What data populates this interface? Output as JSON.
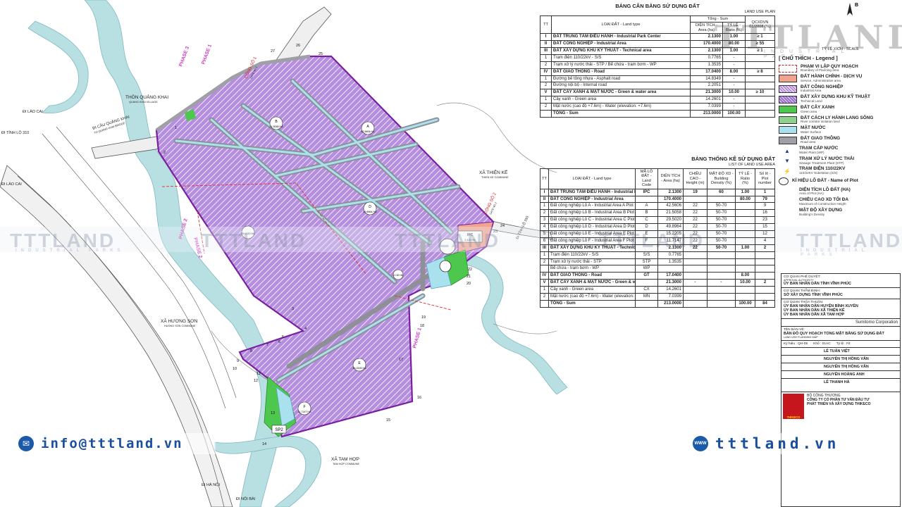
{
  "colors": {
    "industrial_fill": "#b58ee0",
    "industrial_hatch": "#ffffff",
    "boundary": "#7a1fa0",
    "green": "#4ec74e",
    "water": "#a9e2ee",
    "road": "#9f9fa6",
    "service": "#f2a38f",
    "river": "#b8e0e3",
    "watermark": "#8a93a8",
    "brand_blue": "#1a4f9e"
  },
  "map": {
    "labels": {
      "village_quang_khai": "THÔN QUẢNG KHAI",
      "village_quang_khai_en": "QUANG KHAI VILLAGE",
      "bridge": "ĐI CẦU QUẢNG KHAI",
      "bridge_en": "TO QUANG KHAI BRIDGE",
      "to_lao_cai_1": "ĐI LÀO CAI",
      "to_lao_cai_2": "ĐI LÀO CAI",
      "to_tinh_lo_310": "ĐI TỈNH LỘ 310",
      "to_ha_noi": "ĐI HÀ NỘI",
      "to_noi_bai": "ĐI NỘI BÀI",
      "xa_thien_ke": "XÃ THIỆN KẾ",
      "xa_thien_ke_en": "THIEN KE COMMUNE",
      "xa_huong_son": "XÃ HƯƠNG SƠN",
      "xa_huong_son_en": "HUONG SON COMMUNE",
      "xa_tam_hop": "XÃ TAM HỢP",
      "xa_tam_hop_en": "TAM HOP COMMUNE",
      "gate1": "CỔNG SỐ 1",
      "gate1_en": "GATE NO.1",
      "gate2": "CỔNG SỐ 2",
      "gate2_en": "GATE NO.2",
      "tinh_lo_310": "ĐI TỈNH LỘ 310",
      "phase1_a": "PHASE 1",
      "phase1_b": "PHASE 1",
      "phase2_a": "PHASE 2",
      "phase2_b": "PHASE 2",
      "phase3": "PHASE 3",
      "ipc": "IPC",
      "ipc_area": "2.130 HA",
      "sp2": "SP2",
      "plot_a": "A",
      "plot_a_area": "42.5606 HA",
      "plot_b": "B",
      "plot_b_area": "21.5058 HA",
      "plot_d": "D",
      "plot_d_area": "49.8964 HA",
      "plot_c_area": "29.5020 HA",
      "plot_e": "E",
      "plot_e_area": "15.2205 HA",
      "plot_f": "F",
      "plot_f_area": "11.7147 HA",
      "plot_small_area": "2.130 HA"
    },
    "boundary_points": [
      "1",
      "2",
      "3",
      "4",
      "5",
      "6",
      "7",
      "8",
      "9",
      "10",
      "11",
      "12",
      "13",
      "14",
      "15",
      "16",
      "17",
      "18",
      "19",
      "20",
      "21",
      "22",
      "23",
      "24",
      "25",
      "26",
      "27"
    ]
  },
  "land_balance": {
    "title": "BẢNG CÂN BẰNG SỬ DỤNG ĐẤT",
    "subtitle": "LAND USE PLAN",
    "headers": {
      "tt": "TT",
      "land_type": "LOẠI ĐẤT - Land type",
      "total": "Tổng - Sum",
      "area": "DIỆN TÍCH - Area (ha)",
      "ratio": "TỶ LỆ - Ratio (%)",
      "qc": "QCXDVN 01/2008 (%)"
    },
    "rows": [
      {
        "tt": "I",
        "name": "ĐẤT TRUNG TÂM ĐIỀU HÀNH - Industrial Park Center",
        "area": "2.1300",
        "ratio": "1.00",
        "qc": "≥ 1",
        "bold": true
      },
      {
        "tt": "II",
        "name": "ĐẤT CÔNG NGHIỆP - Industrial Area",
        "area": "170.4000",
        "ratio": "80.00",
        "qc": "≥ 55",
        "bold": true
      },
      {
        "tt": "III",
        "name": "ĐẤT XÂY DỰNG KHU KỸ THUẬT - Technical area",
        "area": "2.1300",
        "ratio": "1.00",
        "qc": "≥ 1",
        "bold": true
      },
      {
        "tt": "1",
        "name": "Trạm điện 110/22kV - S/S",
        "area": "0.7765",
        "ratio": "-",
        "qc": "",
        "bold": false
      },
      {
        "tt": "2",
        "name": "Trạm xử lý nước thải - STP / Bể chứa - trạm bơm - WP",
        "area": "1.3535",
        "ratio": "-",
        "qc": "",
        "bold": false
      },
      {
        "tt": "IV",
        "name": "ĐẤT GIAO THÔNG - Road",
        "area": "17.0400",
        "ratio": "8.00",
        "qc": "≥ 8",
        "bold": true
      },
      {
        "tt": "1",
        "name": "Đường bê tông nhựa - Asphalt road",
        "area": "14.8349",
        "ratio": "-",
        "qc": "",
        "bold": false
      },
      {
        "tt": "2",
        "name": "Đường nội bộ - Internal road",
        "area": "2.2051",
        "ratio": "-",
        "qc": "",
        "bold": false
      },
      {
        "tt": "V",
        "name": "ĐẤT CÂY XANH & MẶT NƯỚC - Green & water area",
        "area": "21.3000",
        "ratio": "10.00",
        "qc": "≥ 10",
        "bold": true
      },
      {
        "tt": "1",
        "name": "Cây xanh - Green area",
        "area": "14.2601",
        "ratio": "-",
        "qc": "",
        "bold": false
      },
      {
        "tt": "2",
        "name": "Mặt nước (cao độ +7.6m) - Water (elevation: +7.6m)",
        "area": "7.0399",
        "ratio": "-",
        "qc": "",
        "bold": false
      },
      {
        "tt": "",
        "name": "TỔNG - Sum",
        "area": "213.0000",
        "ratio": "100.00",
        "qc": "",
        "bold": true
      }
    ]
  },
  "land_stats": {
    "title": "BẢNG THỐNG KÊ SỬ DỤNG ĐẤT",
    "subtitle": "LIST OF LAND USE AREA",
    "headers": {
      "tt": "TT",
      "land_type": "LOẠI ĐẤT - Land type",
      "code": "MÃ LÔ ĐẤT - Land Code",
      "area": "DIỆN TÍCH - Area (ha)",
      "height": "CHIỀU CAO - Height (m)",
      "density": "MẬT ĐỘ XD - Building Density (%)",
      "ratio": "TỶ LỆ - Ratio (%)",
      "plots": "Số lô - Plot number"
    },
    "rows": [
      {
        "tt": "I",
        "name": "ĐẤT TRUNG TÂM ĐIỀU HÀNH - Industrial Park Center",
        "code": "IPC",
        "area": "2.1300",
        "height": "19",
        "density": "60",
        "ratio": "1.00",
        "plots": "1"
      },
      {
        "tt": "II",
        "name": "ĐẤT CÔNG NGHIỆP - Industrial Area",
        "code": "",
        "area": "170.4000",
        "height": "",
        "density": "",
        "ratio": "80.00",
        "plots": "79"
      },
      {
        "tt": "1",
        "name": "Đất công nghiệp Lô A - Industrial Area A Plot",
        "code": "A",
        "area": "42.5606",
        "height": "22",
        "density": "50-70",
        "ratio": "",
        "plots": "9"
      },
      {
        "tt": "2",
        "name": "Đất công nghiệp Lô B - Industrial Area B Plot",
        "code": "B",
        "area": "21.5058",
        "height": "22",
        "density": "50-70",
        "ratio": "",
        "plots": "16"
      },
      {
        "tt": "3",
        "name": "Đất công nghiệp Lô C - Industrial Area C Plot",
        "code": "C",
        "area": "29.5020",
        "height": "22",
        "density": "50-70",
        "ratio": "",
        "plots": "23"
      },
      {
        "tt": "4",
        "name": "Đất công nghiệp Lô D - Industrial Area D Plot",
        "code": "D",
        "area": "49.8964",
        "height": "22",
        "density": "50-70",
        "ratio": "",
        "plots": "15"
      },
      {
        "tt": "5",
        "name": "Đất công nghiệp Lô E - Industrial Area E Plot",
        "code": "E",
        "area": "15.2205",
        "height": "22",
        "density": "50-70",
        "ratio": "",
        "plots": "12"
      },
      {
        "tt": "6",
        "name": "Đất công nghiệp Lô F - Industrial Area F Plot",
        "code": "F",
        "area": "11.7147",
        "height": "22",
        "density": "50-70",
        "ratio": "",
        "plots": "4"
      },
      {
        "tt": "III",
        "name": "ĐẤT XÂY DỰNG KHU KỸ THUẬT - Technical area",
        "code": "",
        "area": "2.1300",
        "height": "22",
        "density": "50-70",
        "ratio": "1.00",
        "plots": "2"
      },
      {
        "tt": "1",
        "name": "Trạm điện 110/22kV - S/S",
        "code": "S/S",
        "area": "0.7765",
        "height": "",
        "density": "",
        "ratio": "",
        "plots": ""
      },
      {
        "tt": "2",
        "name": "Trạm xử lý nước thải - STP",
        "code": "STP",
        "area": "1.3535",
        "height": "",
        "density": "",
        "ratio": "",
        "plots": ""
      },
      {
        "tt": "",
        "name": "Bể chứa - trạm bơm - WP",
        "code": "WP",
        "area": "",
        "height": "",
        "density": "",
        "ratio": "",
        "plots": ""
      },
      {
        "tt": "IV",
        "name": "ĐẤT GIAO THÔNG - Road",
        "code": "GT",
        "area": "17.0400",
        "height": "",
        "density": "",
        "ratio": "8.00",
        "plots": ""
      },
      {
        "tt": "V",
        "name": "ĐẤT CÂY XANH & MẶT NƯỚC - Green & water area",
        "code": "",
        "area": "21.3000",
        "height": "-",
        "density": "-",
        "ratio": "10.00",
        "plots": "2"
      },
      {
        "tt": "1",
        "name": "Cây xanh - Green area",
        "code": "CX",
        "area": "14.2601",
        "height": "",
        "density": "",
        "ratio": "",
        "plots": ""
      },
      {
        "tt": "2",
        "name": "Mặt nước (cao độ +7.6m) - Water (elevation: +7.6m)",
        "code": "MN",
        "area": "7.0399",
        "height": "",
        "density": "",
        "ratio": "",
        "plots": ""
      },
      {
        "tt": "",
        "name": "TỔNG - Sum",
        "code": "",
        "area": "213.0000",
        "height": "",
        "density": "",
        "ratio": "100.00",
        "plots": "84"
      }
    ]
  },
  "legend": {
    "title": "[ CHÚ THÍCH - Legend ]",
    "items": [
      {
        "vi": "PHẠM VI LẬP QUY HOẠCH",
        "en": "Boundary of Planning area",
        "kind": "boundary"
      },
      {
        "vi": "ĐẤT HÀNH CHÍNH - DỊCH VỤ",
        "en": "Service, Administrative area",
        "kind": "service"
      },
      {
        "vi": "ĐẤT CÔNG NGHIỆP",
        "en": "Industrial Area",
        "kind": "industrial"
      },
      {
        "vi": "ĐẤT XÂY DỰNG KHU KỸ THUẬT",
        "en": "Technical Land",
        "kind": "technical"
      },
      {
        "vi": "ĐẤT CÂY XANH",
        "en": "Green area",
        "kind": "green"
      },
      {
        "vi": "ĐẤT CÁCH LY HÀNH LANG SÔNG",
        "en": "River corridor isolation land",
        "kind": "river"
      },
      {
        "vi": "MẶT NƯỚC",
        "en": "Water Surface",
        "kind": "water"
      },
      {
        "vi": "ĐẤT GIAO THÔNG",
        "en": "Road area",
        "kind": "road"
      },
      {
        "vi": "TRẠM CẤP NƯỚC",
        "en": "Water Plant (WP)",
        "kind": "wp"
      },
      {
        "vi": "TRẠM XỬ LÝ NƯỚC THẢI",
        "en": "Sewage Treatment Plant (STP)",
        "kind": "stp"
      },
      {
        "vi": "TRẠM ĐIỆN 110/22KV",
        "en": "110/22KV Subelation (S/S)",
        "kind": "ss"
      },
      {
        "vi": "KÍ HIỆU LÔ ĐẤT - Name of Plot",
        "en": "",
        "kind": "plot"
      },
      {
        "vi": "DIỆN TÍCH LÔ ĐẤT (HA)",
        "en": "Area of Plot (HA)",
        "kind": "area"
      },
      {
        "vi": "CHIỀU CAO XD TỐI ĐA",
        "en": "Maximum of Construction Height",
        "kind": "height"
      },
      {
        "vi": "MẬT ĐỘ XÂY DỰNG",
        "en": "Building's Density",
        "kind": "density"
      }
    ]
  },
  "compass_label": "B",
  "scale_text": "TỶ LỆ XÍCH - SCALE",
  "title_block": {
    "approval": "CƠ QUAN PHÊ DUYỆT:",
    "approval_en": "APPROVAL AUTHORITY",
    "approval_org": "ỦY BAN NHÂN DÂN TỈNH VĨNH PHÚC",
    "appraisal": "CƠ QUAN THẨM ĐỊNH:",
    "appraisal_org": "SỞ XÂY DỰNG TỈNH VĨNH PHÚC",
    "agreement": "CƠ QUAN THỎA THUẬN:",
    "agreement_org_1": "ỦY BAN NHÂN DÂN HUYỆN BÌNH XUYÊN",
    "agreement_org_2": "ỦY BAN NHÂN DÂN XÃ THIỆN KẾ",
    "agreement_org_3": "ỦY BAN NHÂN DÂN XÃ TAM HỢP",
    "investor": "Sumitomo Corporation",
    "drawing_name": "TÊN BẢN VẼ:",
    "drawing_title": "BẢN ĐỒ QUY HOẠCH TỔNG MẶT BẰNG SỬ DỤNG ĐẤT",
    "drawing_title_en": "LAND USE PLANNING MAP",
    "code": "Ký hiệu : QH-05",
    "sheet": "Khổ : 01AC",
    "scale": "Tỷ lệ : Fit",
    "designer_1": "LÊ TUẤN VIỆT",
    "designer_2": "NGUYỄN THỊ HỒNG VÂN",
    "designer_3": "NGUYỄN THỊ HỒNG VÂN",
    "designer_4": "NGUYỄN HOÀNG ANH",
    "director": "LÊ THANH HÀ",
    "ministry": "BỘ CÔNG THƯƠNG",
    "company_1": "CÔNG TY CỔ PHẦN TƯ VẤN ĐẦU TƯ",
    "company_2": "PHÁT TRIỂN VÀ XÂY DỰNG THIKECO",
    "company_logo": "THIKECO"
  },
  "watermark": {
    "brand": "TTTLAND",
    "sub": "INDUSTRIAL PARKS"
  },
  "contact": {
    "email": "info@tttland.vn",
    "email_icon": "mail-icon",
    "website": "tttland.vn",
    "web_icon": "globe-icon",
    "web_icon_label": "WWW"
  }
}
